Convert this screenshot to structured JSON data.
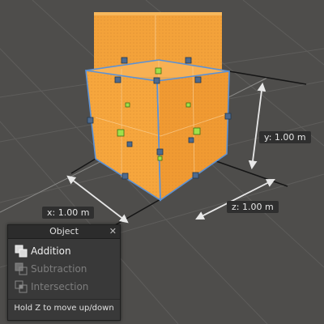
{
  "measurements": {
    "x": "x: 1.00 m",
    "y": "y: 1.00 m",
    "z": "z: 1.00 m"
  },
  "object_panel": {
    "title": "Object",
    "close": "✕",
    "operations": [
      {
        "label": "Addition",
        "active": true
      },
      {
        "label": "Subtraction",
        "active": false
      },
      {
        "label": "Intersection",
        "active": false
      }
    ],
    "hint": "Hold Z to move up/down"
  },
  "colors": {
    "background": "#4e4d4b",
    "shape_orange": "#f5a43a",
    "selection_blue": "#4f8fd8",
    "handle_green": "#8ed63a"
  }
}
